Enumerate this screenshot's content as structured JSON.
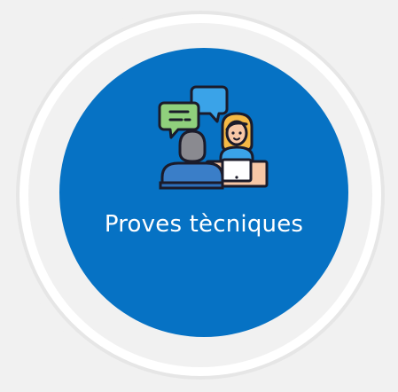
{
  "tile": {
    "label": "Proves tècniques",
    "icon": "interview-icon",
    "background_color": "#0672c4",
    "label_color": "#ffffff"
  }
}
